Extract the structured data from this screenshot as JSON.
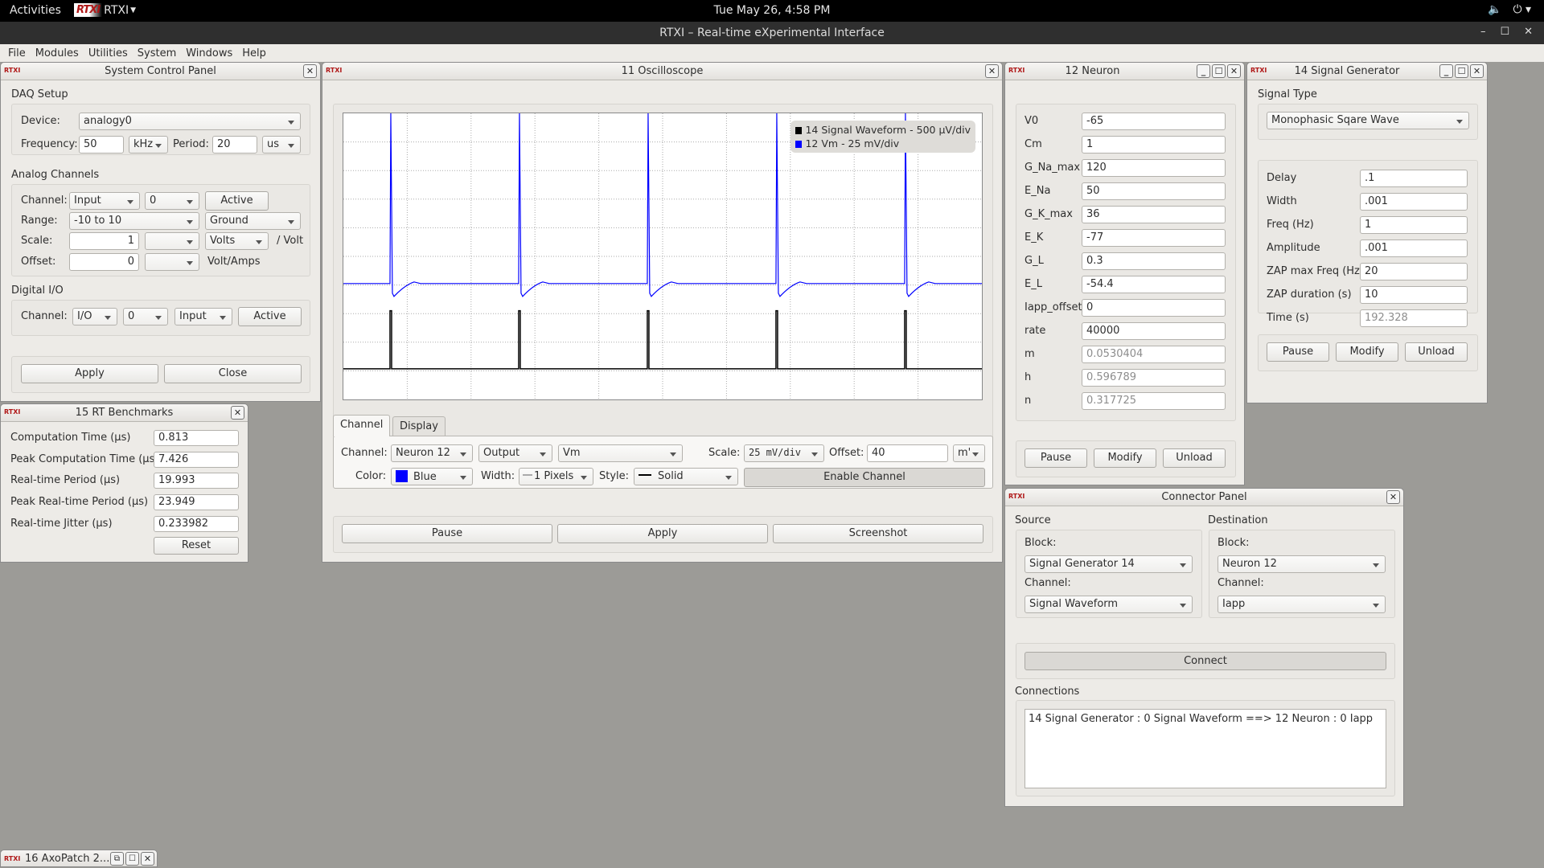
{
  "topbar": {
    "activities": "Activities",
    "app_menu": "RTXI",
    "clock": "Tue May 26,  4:58 PM",
    "volume_icon": "volume-icon",
    "power_icon": "power-icon"
  },
  "app": {
    "title": "RTXI – Real-time eXperimental Interface"
  },
  "menu": [
    "File",
    "Modules",
    "Utilities",
    "System",
    "Windows",
    "Help"
  ],
  "logo_text": "RTXI",
  "system_control_panel": {
    "title": "System Control Panel",
    "daq_setup": "DAQ Setup",
    "device_label": "Device:",
    "device": "analogy0",
    "frequency_label": "Frequency:",
    "frequency": "50",
    "frequency_unit": "kHz",
    "period_label": "Period:",
    "period": "20",
    "period_unit": "us",
    "analog_channels": "Analog Channels",
    "channel_label": "Channel:",
    "channel_type": "Input",
    "channel_num": "0",
    "active": "Active",
    "range_label": "Range:",
    "range": "-10 to 10",
    "reference": "Ground",
    "scale_label": "Scale:",
    "scale": "1",
    "scale_prefix": "",
    "scale_unit": "Volts",
    "scale_suffix": "/ Volt",
    "offset_label": "Offset:",
    "offset": "0",
    "offset_prefix": "",
    "offset_suffix": "Volt/Amps",
    "digital_io": "Digital I/O",
    "dio_channel_label": "Channel:",
    "dio_type": "I/O",
    "dio_num": "0",
    "dio_dir": "Input",
    "dio_active": "Active",
    "apply": "Apply",
    "close": "Close"
  },
  "benchmarks": {
    "title": "15 RT Benchmarks",
    "rows": [
      {
        "label": "Computation Time (µs)",
        "value": "0.813"
      },
      {
        "label": "Peak Computation Time (µs)",
        "value": "7.426"
      },
      {
        "label": "Real-time Period (µs)",
        "value": "19.993"
      },
      {
        "label": "Peak Real-time Period (µs)",
        "value": "23.949"
      },
      {
        "label": "Real-time Jitter (µs)",
        "value": "0.233982"
      }
    ],
    "reset": "Reset"
  },
  "oscilloscope": {
    "title": "11 Oscilloscope",
    "legend": [
      {
        "label": "14 Signal Waveform - 500 µV/div",
        "color": "#000000"
      },
      {
        "label": "12 Vm - 25 mV/div",
        "color": "#0000ff"
      }
    ],
    "tabs": [
      "Channel",
      "Display"
    ],
    "channel_label": "Channel:",
    "channel_block": "Neuron 12",
    "channel_type": "Output",
    "channel_name": "Vm",
    "scale_label": "Scale:",
    "scale": "25 mV/div",
    "offset_label": "Offset:",
    "offset": "40",
    "offset_unit": "m'",
    "color_label": "Color:",
    "color": "Blue",
    "color_hex": "#0000ff",
    "width_label": "Width:",
    "width": "1 Pixels",
    "style_label": "Style:",
    "style": "Solid",
    "enable_channel": "Enable Channel",
    "pause": "Pause",
    "apply": "Apply",
    "screenshot": "Screenshot"
  },
  "neuron": {
    "title": "12 Neuron",
    "params": [
      {
        "label": "V0",
        "value": "-65",
        "readonly": false
      },
      {
        "label": "Cm",
        "value": "1",
        "readonly": false
      },
      {
        "label": "G_Na_max",
        "value": "120",
        "readonly": false
      },
      {
        "label": "E_Na",
        "value": "50",
        "readonly": false
      },
      {
        "label": "G_K_max",
        "value": "36",
        "readonly": false
      },
      {
        "label": "E_K",
        "value": "-77",
        "readonly": false
      },
      {
        "label": "G_L",
        "value": "0.3",
        "readonly": false
      },
      {
        "label": "E_L",
        "value": "-54.4",
        "readonly": false
      },
      {
        "label": "Iapp_offset",
        "value": "0",
        "readonly": false
      },
      {
        "label": "rate",
        "value": "40000",
        "readonly": false
      },
      {
        "label": "m",
        "value": "0.0530404",
        "readonly": true
      },
      {
        "label": "h",
        "value": "0.596789",
        "readonly": true
      },
      {
        "label": "n",
        "value": "0.317725",
        "readonly": true
      }
    ],
    "pause": "Pause",
    "modify": "Modify",
    "unload": "Unload"
  },
  "signal_generator": {
    "title": "14 Signal Generator",
    "signal_type_label": "Signal Type",
    "signal_type": "Monophasic Sqare Wave",
    "params": [
      {
        "label": "Delay",
        "value": ".1",
        "readonly": false
      },
      {
        "label": "Width",
        "value": ".001",
        "readonly": false
      },
      {
        "label": "Freq (Hz)",
        "value": "1",
        "readonly": false
      },
      {
        "label": "Amplitude",
        "value": ".001",
        "readonly": false
      },
      {
        "label": "ZAP max Freq (Hz)",
        "value": "20",
        "readonly": false
      },
      {
        "label": "ZAP duration (s)",
        "value": "10",
        "readonly": false
      },
      {
        "label": "Time (s)",
        "value": "192.328",
        "readonly": true
      }
    ],
    "pause": "Pause",
    "modify": "Modify",
    "unload": "Unload"
  },
  "connector": {
    "title": "Connector Panel",
    "source": "Source",
    "destination": "Destination",
    "block_label": "Block:",
    "channel_label": "Channel:",
    "src_block": "Signal Generator 14",
    "src_channel": "Signal Waveform",
    "dst_block": "Neuron 12",
    "dst_channel": "Iapp",
    "connect": "Connect",
    "connections_label": "Connections",
    "connections": [
      "14 Signal Generator : 0 Signal Waveform ==> 12 Neuron : 0 Iapp"
    ]
  },
  "axopatch": {
    "title": "16 AxoPatch 2..."
  }
}
